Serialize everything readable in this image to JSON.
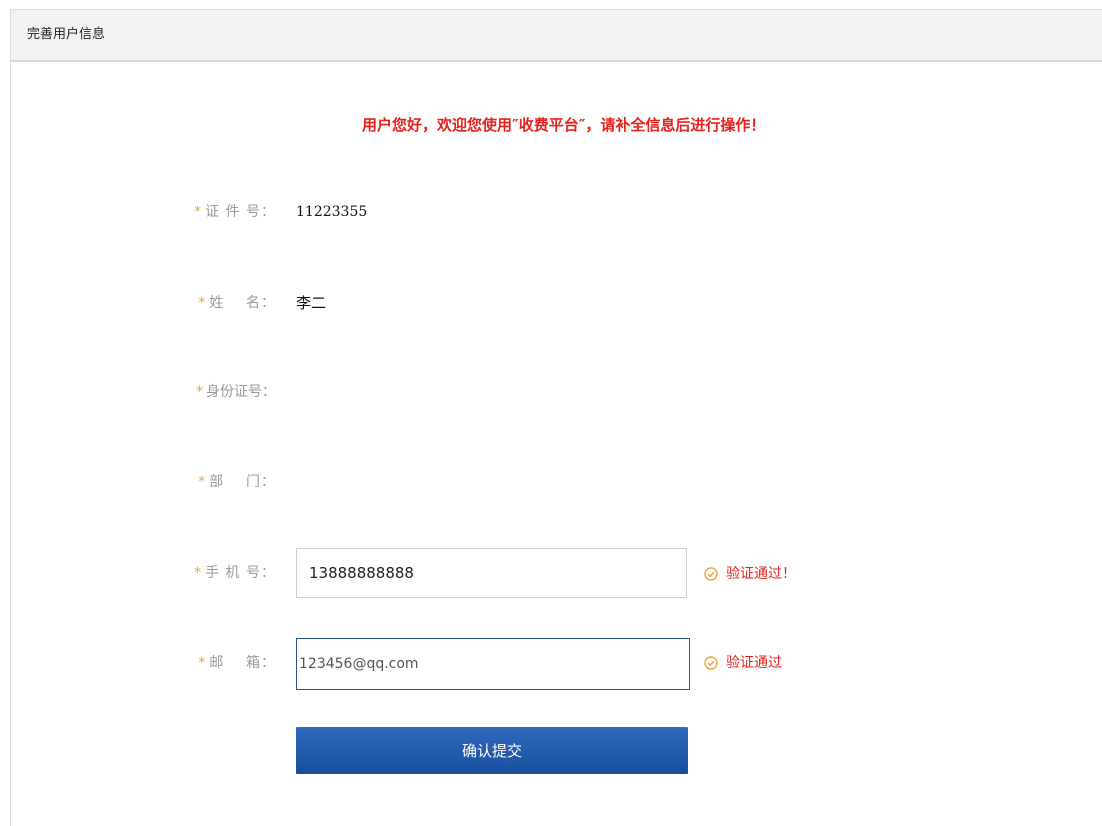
{
  "header": {
    "title": "完善用户信息"
  },
  "welcome_message": "用户您好，欢迎您使用″收费平台″，请补全信息后进行操作！",
  "form": {
    "required_mark": "*",
    "fields": {
      "cert_no": {
        "label": "证 件 号：",
        "value": "11223355"
      },
      "name": {
        "label": "姓    名：",
        "value": "李二"
      },
      "id_card": {
        "label": "身份证号：",
        "value": ""
      },
      "department": {
        "label": "部    门：",
        "value": ""
      },
      "phone": {
        "label": "手 机 号：",
        "value": "13888888888",
        "status": "验证通过！"
      },
      "email": {
        "label": "邮    箱：",
        "value": "123456@qq.com",
        "status": "验证通过"
      }
    },
    "submit_label": "确认提交"
  },
  "colors": {
    "accent_red": "#e8211d",
    "required_star": "#f0a23c",
    "button_blue": "#1f5aa8",
    "valid_icon": "#f0a23c"
  },
  "icons": {
    "valid": "check-circle-icon"
  }
}
